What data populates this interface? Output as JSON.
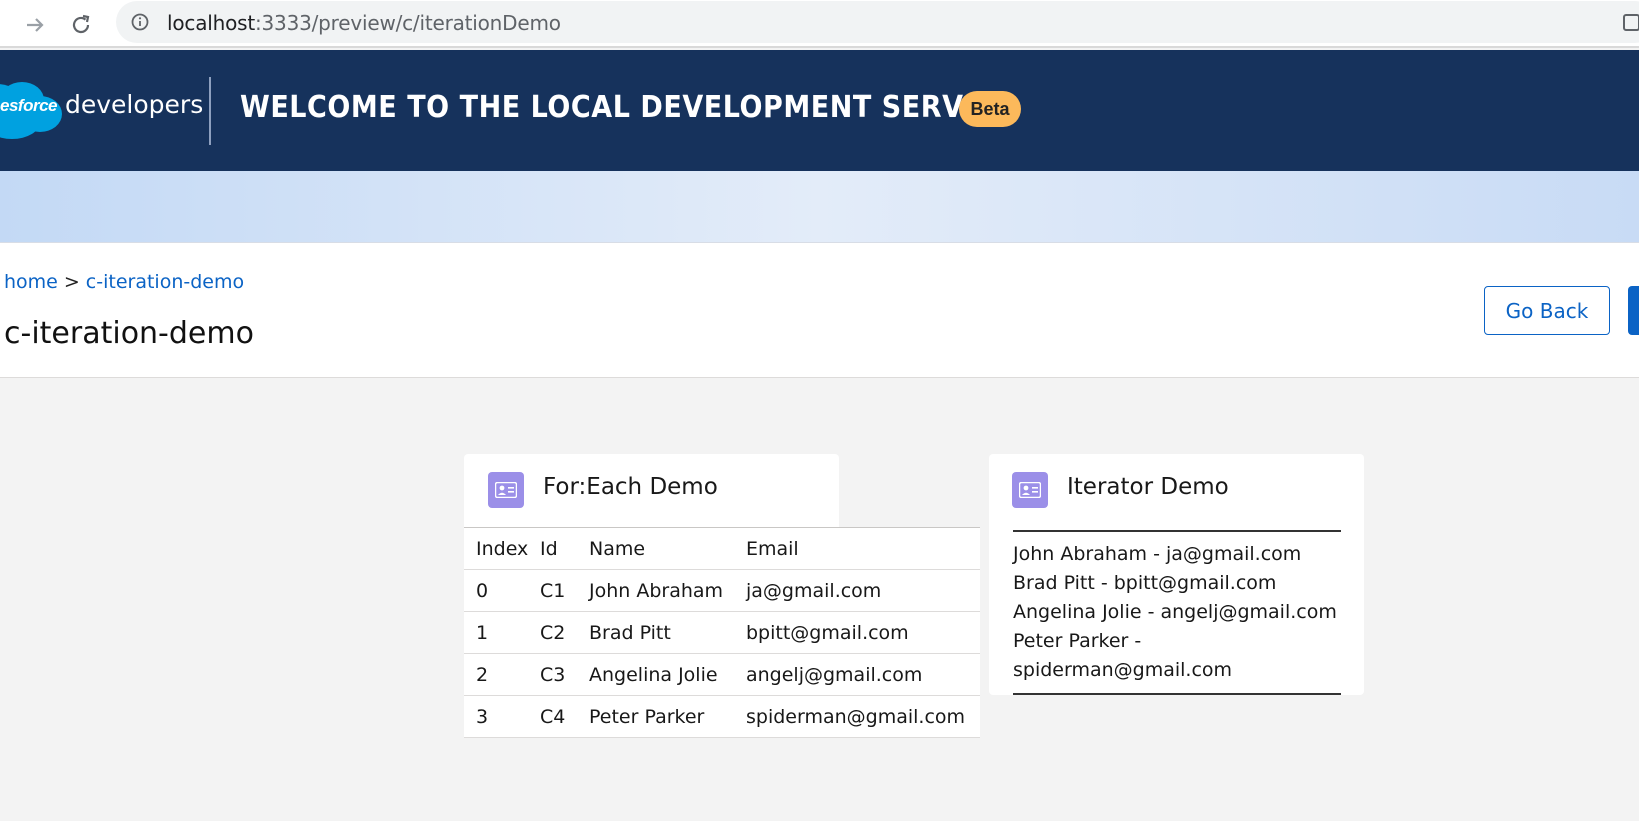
{
  "browser": {
    "url_host": "localhost",
    "url_rest": ":3333/preview/c/iterationDemo"
  },
  "header": {
    "logo_cloud_text": "esforce",
    "logo_text": "developers",
    "title": "WELCOME TO THE LOCAL DEVELOPMENT SERVER",
    "badge": "Beta"
  },
  "page": {
    "breadcrumb_home": "home",
    "breadcrumb_separator": ">",
    "breadcrumb_current": "c-iteration-demo",
    "title": "c-iteration-demo",
    "go_back_label": "Go Back"
  },
  "foreach_card": {
    "title": "For:Each Demo",
    "columns": [
      "Index",
      "Id",
      "Name",
      "Email"
    ],
    "rows": [
      {
        "index": "0",
        "id": "C1",
        "name": "John Abraham",
        "email": "ja@gmail.com"
      },
      {
        "index": "1",
        "id": "C2",
        "name": "Brad Pitt",
        "email": "bpitt@gmail.com"
      },
      {
        "index": "2",
        "id": "C3",
        "name": "Angelina Jolie",
        "email": "angelj@gmail.com"
      },
      {
        "index": "3",
        "id": "C4",
        "name": "Peter Parker",
        "email": "spiderman@gmail.com"
      }
    ]
  },
  "iterator_card": {
    "title": "Iterator Demo",
    "items": [
      "John Abraham - ja@gmail.com",
      "Brad Pitt - bpitt@gmail.com",
      "Angelina Jolie - angelj@gmail.com",
      "Peter Parker - spiderman@gmail.com"
    ]
  },
  "colors": {
    "header_bg": "#16325c",
    "badge_bg": "#fcb95b",
    "link": "#0b63c5",
    "card_icon": "#9b8fe8"
  }
}
